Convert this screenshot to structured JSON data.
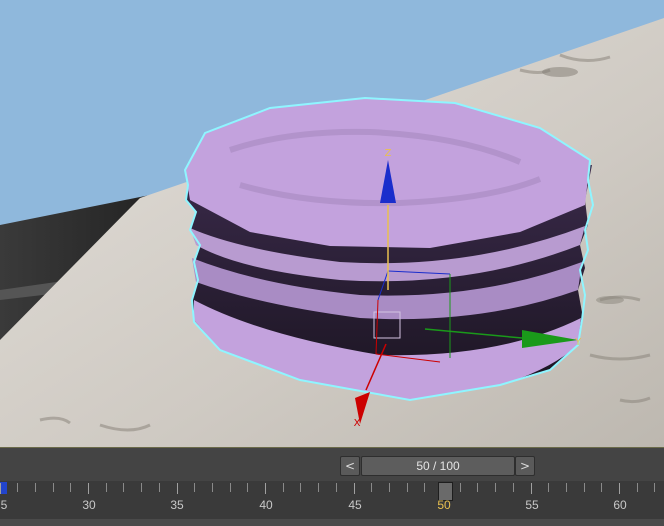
{
  "viewport": {
    "gizmo": {
      "z_label": "Z",
      "y_label": "Y",
      "x_label": "X",
      "colors": {
        "x": "#cc0000",
        "y": "#1a9a1a",
        "z": "#1a2dcc"
      }
    },
    "object": {
      "color": "#c3a2dd",
      "selection_outline": "#8ff5ff"
    }
  },
  "timeline": {
    "prev_label": "<",
    "next_label": ">",
    "frame_display": "50 / 100",
    "ticks": [
      "5",
      "30",
      "35",
      "40",
      "45",
      "50",
      "55",
      "60"
    ],
    "current_frame": 50,
    "total_frames": 100
  }
}
